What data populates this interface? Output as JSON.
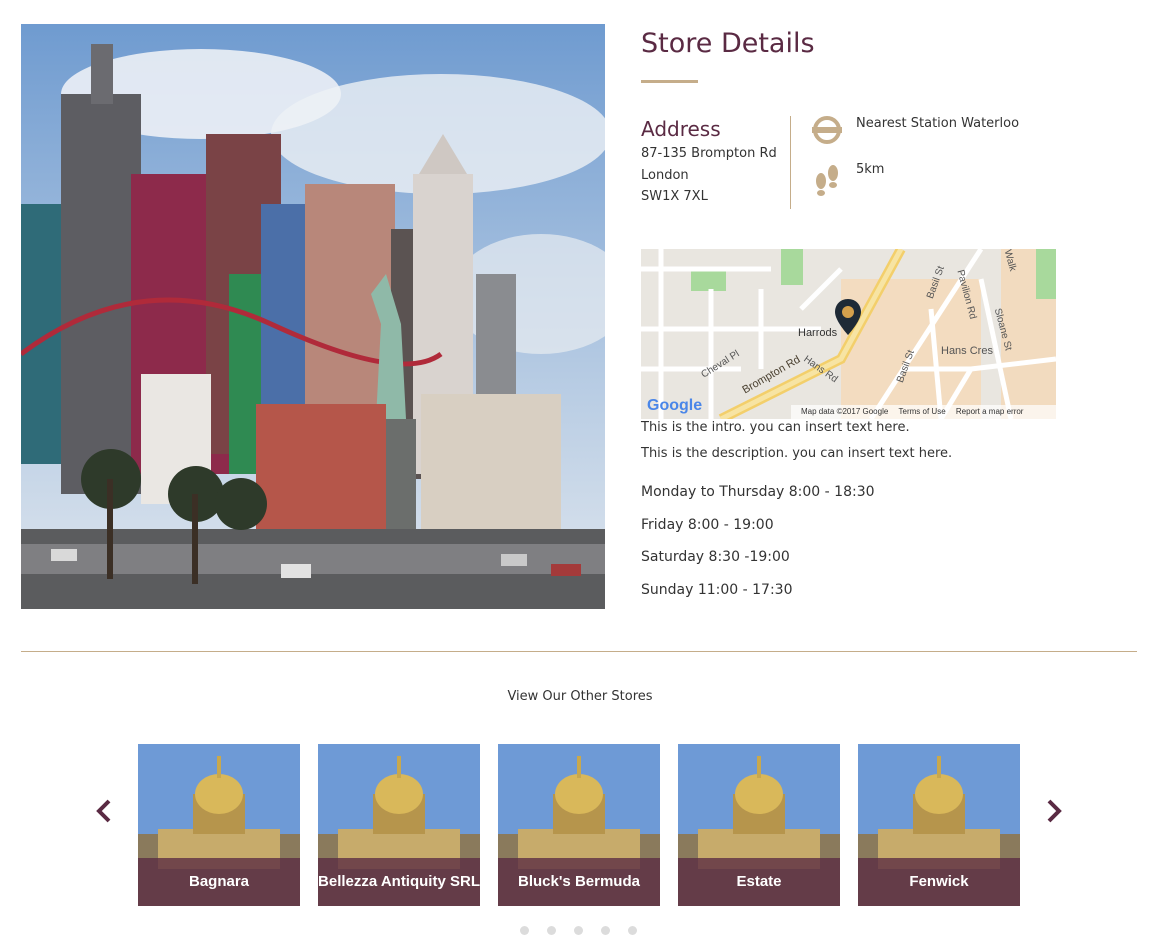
{
  "store": {
    "title": "Store Details",
    "address_heading": "Address",
    "address_lines": [
      "87-135 Brompton Rd",
      "London",
      "SW1X 7XL"
    ],
    "nearest_station": "Nearest Station Waterloo",
    "distance": "5km",
    "intro": "This is the intro. you can insert text here.",
    "description": "This is the description. you can insert text here.",
    "hours": [
      "Monday to Thursday 8:00 - 18:30",
      "Friday 8:00 - 19:00",
      "Saturday 8:30 -19:00",
      "Sunday 11:00 - 17:30"
    ]
  },
  "map": {
    "pin_label": "Harrods",
    "streets": [
      "Cheval Pl",
      "Brompton Rd",
      "Hans Rd",
      "Basil St",
      "Basil St",
      "Pavilion Rd",
      "Sloane St",
      "Hans Cres",
      "Walk"
    ],
    "google": "Google",
    "footer": [
      "Map data ©2017 Google",
      "Terms of Use",
      "Report a map error"
    ]
  },
  "other_stores": {
    "heading": "View Our Other Stores",
    "cards": [
      "Bagnara",
      "Bellezza Antiquity SRL",
      "Bluck's Bermuda",
      "Estate",
      "Fenwick"
    ],
    "dots": 5
  },
  "colors": {
    "accent": "#5a2a43",
    "gold": "#c5ad8a"
  },
  "icons": {
    "station": "underground-roundel-icon",
    "distance": "footprints-icon",
    "prev": "chevron-left-icon",
    "next": "chevron-right-icon",
    "pin": "map-pin-icon"
  }
}
